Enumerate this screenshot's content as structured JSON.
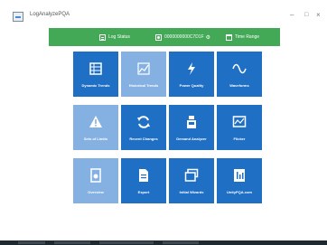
{
  "window": {
    "title": "LogAnalyzePQA"
  },
  "status_bar": {
    "log_status_label": "Log Status",
    "device_id": "0000000000C7D1F",
    "time_range_label": "Time Range"
  },
  "tiles": [
    {
      "label": "Dynamic Trends",
      "icon": "table-icon",
      "enabled": true
    },
    {
      "label": "Historical Trends",
      "icon": "chart-icon",
      "enabled": false
    },
    {
      "label": "Power Quality",
      "icon": "bolt-icon",
      "enabled": true
    },
    {
      "label": "Waveforms",
      "icon": "wave-icon",
      "enabled": true
    },
    {
      "label": "Sets of Limits",
      "icon": "warning-icon",
      "enabled": false
    },
    {
      "label": "Recent Changes",
      "icon": "refresh-icon",
      "enabled": true
    },
    {
      "label": "Demand Analyzer",
      "icon": "meter-icon",
      "enabled": true
    },
    {
      "label": "Flicker",
      "icon": "monitor-icon",
      "enabled": true
    },
    {
      "label": "Overview",
      "icon": "document-icon",
      "enabled": false
    },
    {
      "label": "Export",
      "icon": "export-icon",
      "enabled": true
    },
    {
      "label": "Initial Wizards",
      "icon": "window-icon",
      "enabled": true
    },
    {
      "label": "UnityPQA.com",
      "icon": "web-icon",
      "enabled": true
    }
  ],
  "colors": {
    "status_bar": "#43a956",
    "tile": "#1f6fc5",
    "tile_disabled": "#84b1e2"
  }
}
